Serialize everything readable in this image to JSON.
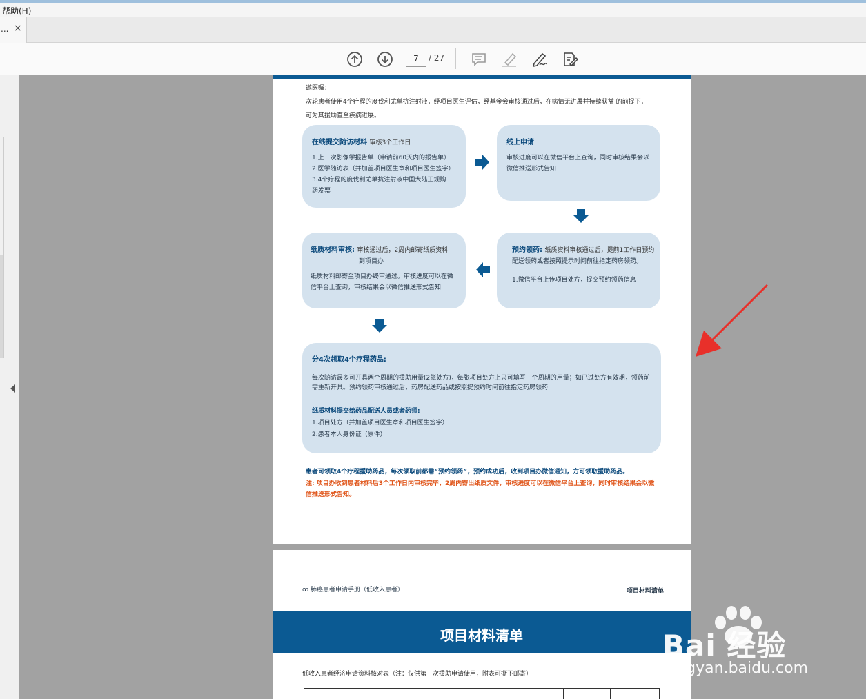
{
  "menu": {
    "help": "帮助(H)"
  },
  "tab": {
    "dots": "...",
    "close": "×"
  },
  "toolbar": {
    "current_page": "7",
    "total_pages": "/ 27",
    "icons": [
      "arrow-up-circle-icon",
      "arrow-down-circle-icon",
      "comment-icon",
      "highlight-pen-icon",
      "sign-icon",
      "edit-form-icon"
    ]
  },
  "page1": {
    "label_line": "邀医嘱：",
    "intro_line1": "次轮患者使用4个疗程的度伐利尤单抗注射液，经项目医生评估，经基金会审核通过后，在病情无进展并持续获益 的前提下，",
    "intro_line2": "可为其援助直至疾病进展。",
    "box1": {
      "title": "在线提交随访材料",
      "title_note": "审核3个工作日",
      "items": [
        "1.上一次影像学报告单（申请前60天内的报告单）",
        "2.医学随访表（并加盖项目医生章和项目医生签字）",
        "3.4个疗程的度伐利尤单抗注射液中国大陆正规购",
        "药发票"
      ]
    },
    "box2": {
      "title": "线上申请",
      "lines": [
        "审核进度可以在微信平台上查询，同时审核结果会以",
        "微信推送形式告知"
      ]
    },
    "box3": {
      "title": "纸质材料审核:",
      "title_note": "审核通过后，2周内邮寄纸质资料",
      "title_note2": "到项目办",
      "lines": [
        "纸质材料邮寄至项目办终审通过。审核进度可以在微",
        "信平台上查询，审核结果会以微信推送形式告知"
      ]
    },
    "box4": {
      "title": "预约领药:",
      "title_note": "纸质资料审核通过后，提前1工作日预约",
      "line2": "配送领药或者按照提示时间前往指定药房领药。",
      "line3": "1.微信平台上传项目处方，提交预约领药信息"
    },
    "box5": {
      "title": "分4次领取4个疗程药品:",
      "para1": "每次随访最多可开具两个周期的援助用量(2张处方)，每张项目处方上只可填写一个周期的用量；如已过处方有效期，领药前",
      "para2": "需重新开具。预约领药审核通过后，药房配送药品或按照提预约时间前往指定药房领药",
      "subtitle": "纸质材料提交给药品配送人员或者药师:",
      "item1": "1.项目处方（并加盖项目医生章和项目医生签字）",
      "item2": "2.患者本人身份证（原件）"
    },
    "note_blue": "患者可领取4个疗程援助药品，每次领取前都需“预约领药”，预约成功后，收到项目办微信通知，方可领取援助药品。",
    "note_orange1": "注: 项目办收到患者材料后3个工作日内审核完毕，2周内寄出纸质文件，审核进度可以在微信平台上查询，同时审核结果会以微",
    "note_orange2": "信推送形式告知。"
  },
  "page2": {
    "header_left": "肺癌患者申请手册（低收入患者）",
    "header_right": "项目材料清单",
    "title": "项目材料清单",
    "subtitle": "低收入患者经济申请资料核对表（注：仅供第一次援助申请使用，附表可撕下邮寄）"
  },
  "watermark": {
    "line1": "Bai 经验",
    "line2": "jingyan.baidu.com"
  },
  "colors": {
    "accent": "#0b5a93",
    "box": "#d4e2ee",
    "orange": "#e0561b",
    "annotation": "#e8302a"
  }
}
